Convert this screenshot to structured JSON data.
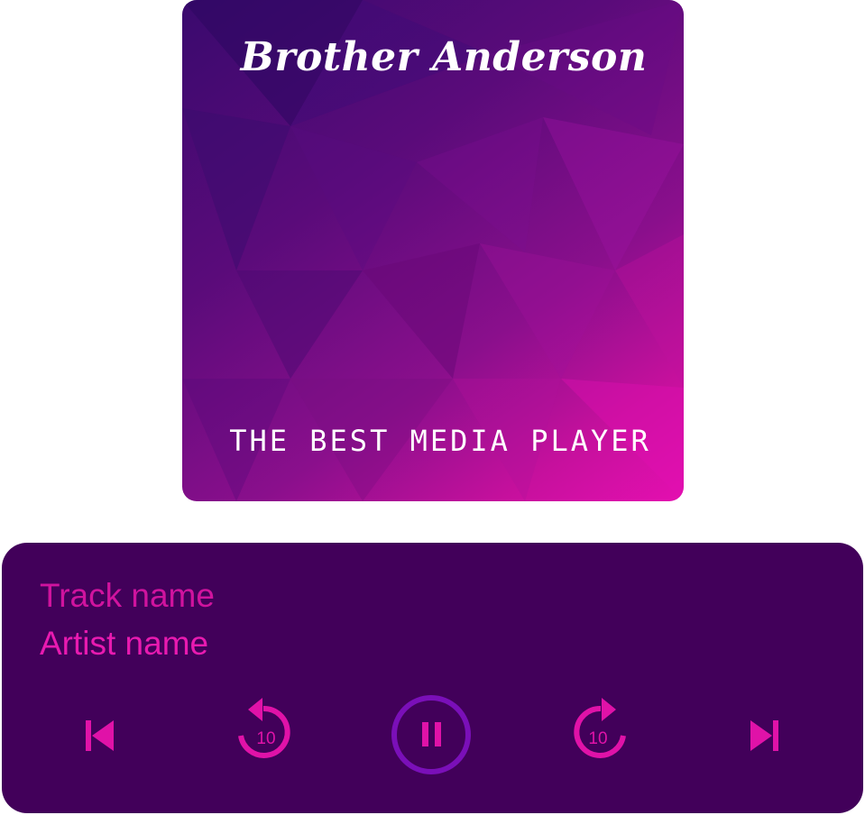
{
  "album": {
    "title": "Brother Anderson",
    "subtitle": "THE BEST MEDIA PLAYER"
  },
  "player": {
    "track_name": "Track name",
    "artist_name": "Artist name",
    "controls": {
      "previous_icon": "skip-previous-icon",
      "rewind_icon": "replay-10-icon",
      "rewind_seconds": "10",
      "play_pause_icon": "pause-icon",
      "forward_icon": "forward-10-icon",
      "forward_seconds": "10",
      "next_icon": "skip-next-icon"
    }
  },
  "colors": {
    "panel_bg": "#42005a",
    "accent": "#e012a8",
    "pause_ring": "#7a0fb8"
  }
}
